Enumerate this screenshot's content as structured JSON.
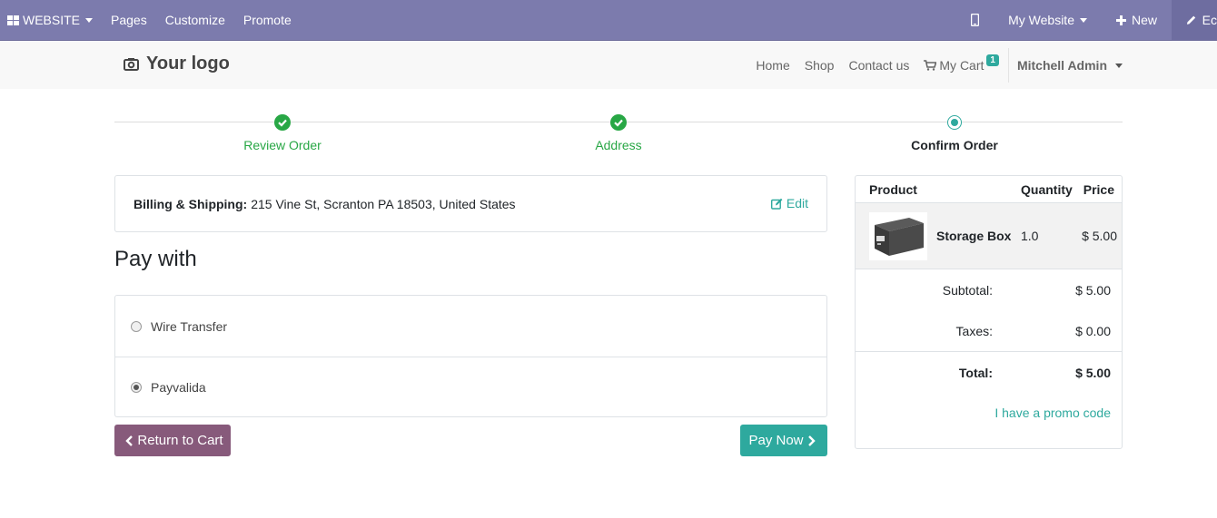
{
  "admin_bar": {
    "website_label": "WEBSITE",
    "pages_label": "Pages",
    "customize_label": "Customize",
    "promote_label": "Promote",
    "my_website_label": "My Website",
    "new_label": "New",
    "edit_label": "Ec",
    "bg_color": "#7c7bad"
  },
  "site_header": {
    "logo_text": "Your logo",
    "nav": {
      "home": "Home",
      "shop": "Shop",
      "contact": "Contact us",
      "cart": "My Cart",
      "cart_count": "1"
    },
    "user_name": "Mitchell Admin"
  },
  "steps": [
    {
      "label": "Review Order",
      "state": "done"
    },
    {
      "label": "Address",
      "state": "done"
    },
    {
      "label": "Confirm Order",
      "state": "current"
    }
  ],
  "billing": {
    "label": "Billing & Shipping:",
    "address": "215 Vine St, Scranton PA 18503, United States",
    "edit_label": "Edit"
  },
  "pay_with_title": "Pay with",
  "payment_methods": [
    {
      "label": "Wire Transfer",
      "checked": false
    },
    {
      "label": "Payvalida",
      "checked": true
    }
  ],
  "buttons": {
    "return_label": "Return to Cart",
    "pay_label": "Pay Now"
  },
  "summary": {
    "headers": {
      "product": "Product",
      "quantity": "Quantity",
      "price": "Price"
    },
    "items": [
      {
        "name": "Storage Box",
        "quantity": "1.0",
        "price": "$ 5.00"
      }
    ],
    "subtotal_label": "Subtotal:",
    "subtotal_value": "$ 5.00",
    "taxes_label": "Taxes:",
    "taxes_value": "$ 0.00",
    "total_label": "Total:",
    "total_value": "$ 5.00",
    "promo_label": "I have a promo code"
  },
  "colors": {
    "primary": "#875a7b",
    "accent": "#2ea99e",
    "success": "#28a745"
  }
}
